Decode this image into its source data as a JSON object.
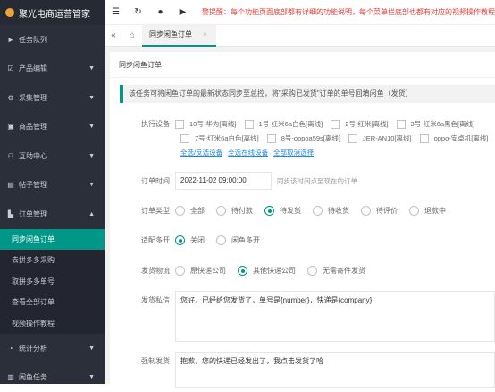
{
  "app": {
    "title": "聚光电商运营管家"
  },
  "sidebar": {
    "items": [
      {
        "label": "任务队列",
        "icon": "►"
      },
      {
        "label": "产品编辑",
        "icon": "☑"
      },
      {
        "label": "采集管理",
        "icon": "⚙"
      },
      {
        "label": "商品管理",
        "icon": "▣"
      },
      {
        "label": "互助中心",
        "icon": "⚇"
      },
      {
        "label": "帖子管理",
        "icon": "▤"
      },
      {
        "label": "订单管理",
        "icon": "▙"
      }
    ],
    "order_sub": [
      {
        "label": "同步闲鱼订单"
      },
      {
        "label": "去拼多多采购"
      },
      {
        "label": "取拼多多单号"
      },
      {
        "label": "查看全部订单"
      },
      {
        "label": "视频操作教程"
      }
    ],
    "after": [
      {
        "label": "统计分析",
        "icon": "◔"
      },
      {
        "label": "闲鱼任务",
        "icon": "▥"
      }
    ]
  },
  "topbar": {
    "notice": "警提醒：每个功能页面底部都有详细的功能说明，每个菜单栏底部也都有对应的视频操作教程"
  },
  "tabs": {
    "prev": "«",
    "home": "⌂",
    "active": "同步闲鱼订单",
    "close": "×"
  },
  "card": {
    "title": "同步闲鱼订单",
    "tip": "该任务可将闲鱼订单的最新状态同步至总控，将\"采购已发货\"订单的单号回填闲鱼（发货）"
  },
  "form": {
    "devices_label": "执行设备",
    "devices_row1": [
      "10号-华为[离线]",
      "1号-红米6a白色[离线]",
      "2号-红米[离线]",
      "3号-红米6a黑色[离线]"
    ],
    "devices_row2": [
      "7号-红米6a白色[离线]",
      "8号-oppoa59s[离线]",
      "JER-AN10[离线]",
      "oppo-安卓机[离线]"
    ],
    "links": [
      "全选/反选设备",
      "全选在线设备",
      "全部取消选择"
    ],
    "time_label": "订单时间",
    "time_value": "2022-11-02 09:00:00",
    "time_hint": "同步该时间点至现在的订单",
    "type_label": "订单类型",
    "type_options": [
      "全部",
      "待付款",
      "待发货",
      "待收货",
      "待评价",
      "退款中"
    ],
    "type_selected": 2,
    "multi_label": "适配多开",
    "multi_options": [
      "关闭",
      "闲鱼多开"
    ],
    "multi_selected": 0,
    "logistics_label": "发货物流",
    "logistics_options": [
      "原快递公司",
      "其他快递公司",
      "无需寄件发货"
    ],
    "logistics_selected": 1,
    "msg_label": "发货私信",
    "msg_value": "您好，已经给您发货了，单号是{number}，快递是{company}",
    "force_label": "强制发货",
    "force_value": "抱歉，您的快递已经发出了，我点击发货了哈"
  },
  "colors": {
    "accent": "#009688",
    "sidebar_bg": "#2b2f3a",
    "notice": "#e53935"
  }
}
